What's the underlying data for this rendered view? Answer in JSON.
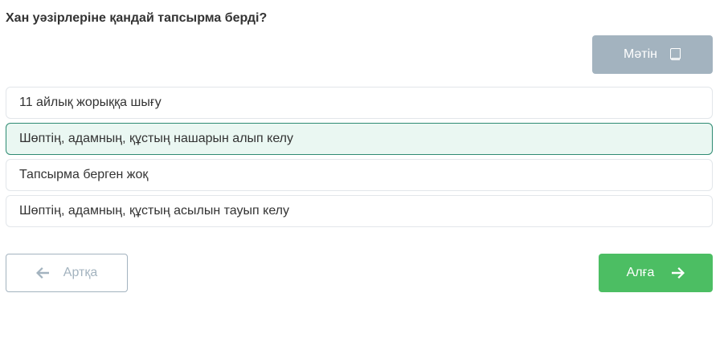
{
  "question": {
    "text": "Хан уәзірлеріне қандай тапсырма берді?"
  },
  "text_button": {
    "label": "Мәтін",
    "icon": "book-icon"
  },
  "options": [
    {
      "label": "11 айлық жорыққа шығу",
      "selected": false
    },
    {
      "label": "Шөптің, адамның, құстың нашарын алып келу",
      "selected": true
    },
    {
      "label": "Тапсырма берген жоқ",
      "selected": false
    },
    {
      "label": "Шөптің, адамның, құстың асылын тауып келу",
      "selected": false
    }
  ],
  "navigation": {
    "back_label": "Артқа",
    "back_icon": "arrow-left-icon",
    "next_label": "Алға",
    "next_icon": "arrow-right-icon"
  },
  "colors": {
    "text_button_bg": "#a3b3bf",
    "selected_border": "#2e8b72",
    "selected_bg": "#eaf7f2",
    "next_button_bg": "#4cbe63"
  }
}
